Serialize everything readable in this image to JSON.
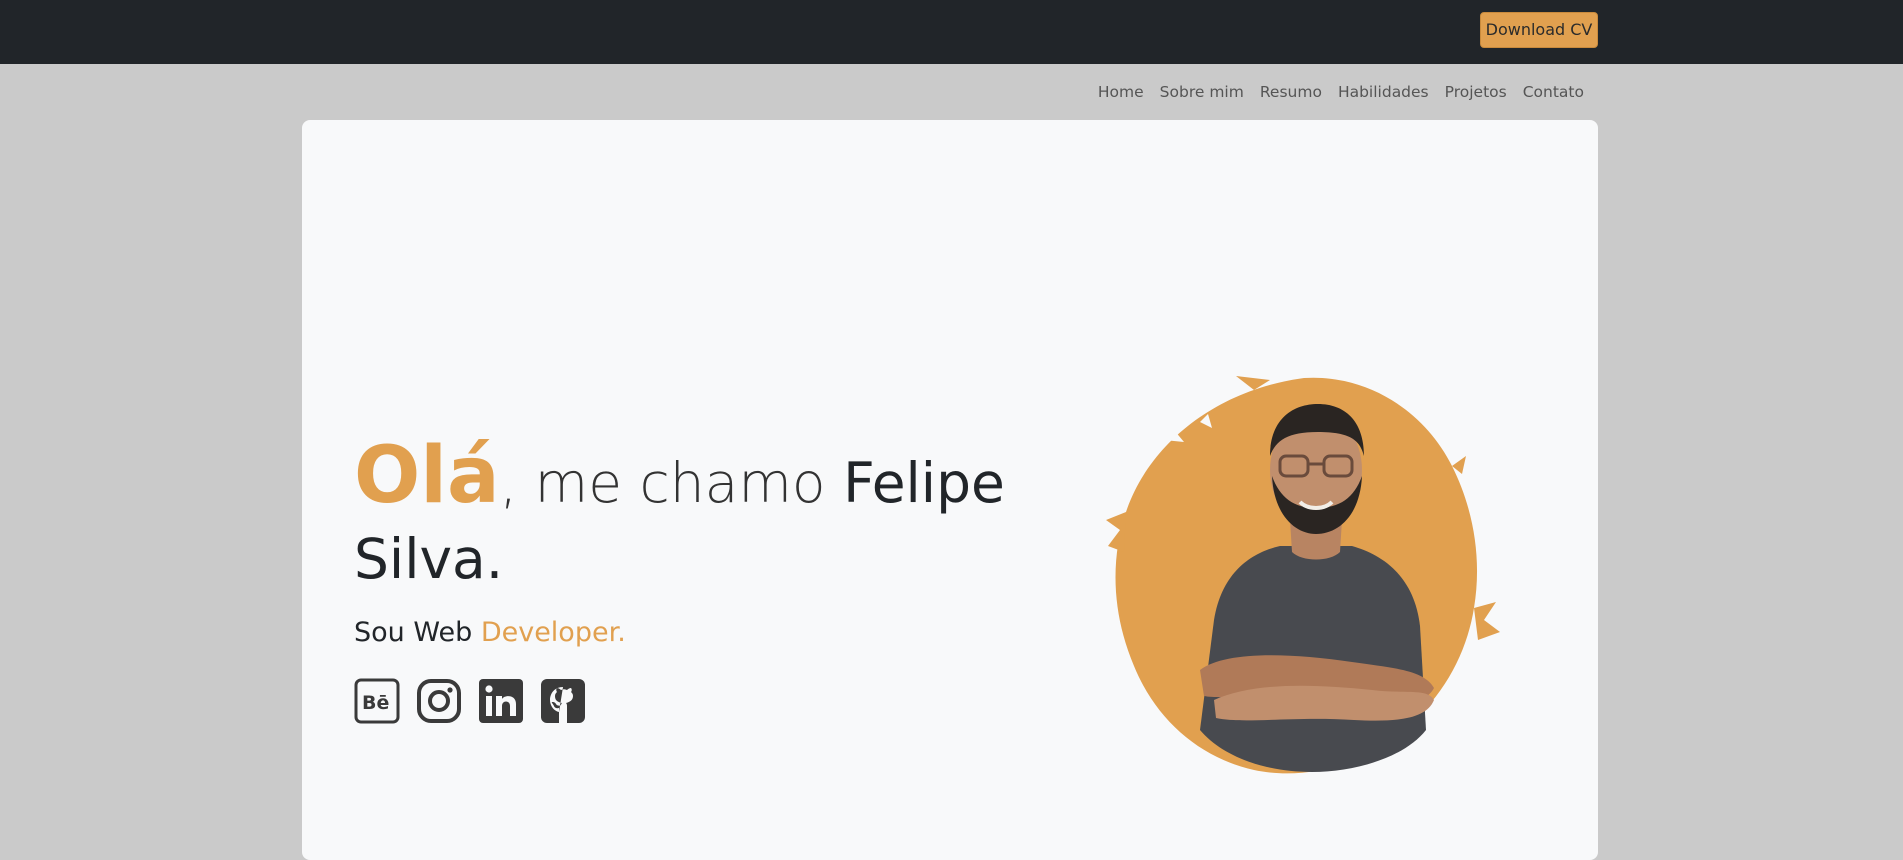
{
  "header": {
    "download_label": "Download CV"
  },
  "nav": {
    "items": [
      {
        "label": "Home"
      },
      {
        "label": "Sobre mim"
      },
      {
        "label": "Resumo"
      },
      {
        "label": "Habilidades"
      },
      {
        "label": "Projetos"
      },
      {
        "label": "Contato"
      }
    ]
  },
  "hero": {
    "greeting": "Olá",
    "intro": ", me chamo ",
    "name_first": "Felipe",
    "name_last": "Silva.",
    "role_prefix": "Sou Web ",
    "role_accent": "Developer.",
    "socials": [
      {
        "icon": "behance-icon"
      },
      {
        "icon": "instagram-icon"
      },
      {
        "icon": "linkedin-icon"
      },
      {
        "icon": "github-icon"
      }
    ]
  },
  "colors": {
    "accent": "#e1a04f",
    "topbar": "#212529",
    "background": "#cacaca",
    "card": "#f8f9fa"
  }
}
